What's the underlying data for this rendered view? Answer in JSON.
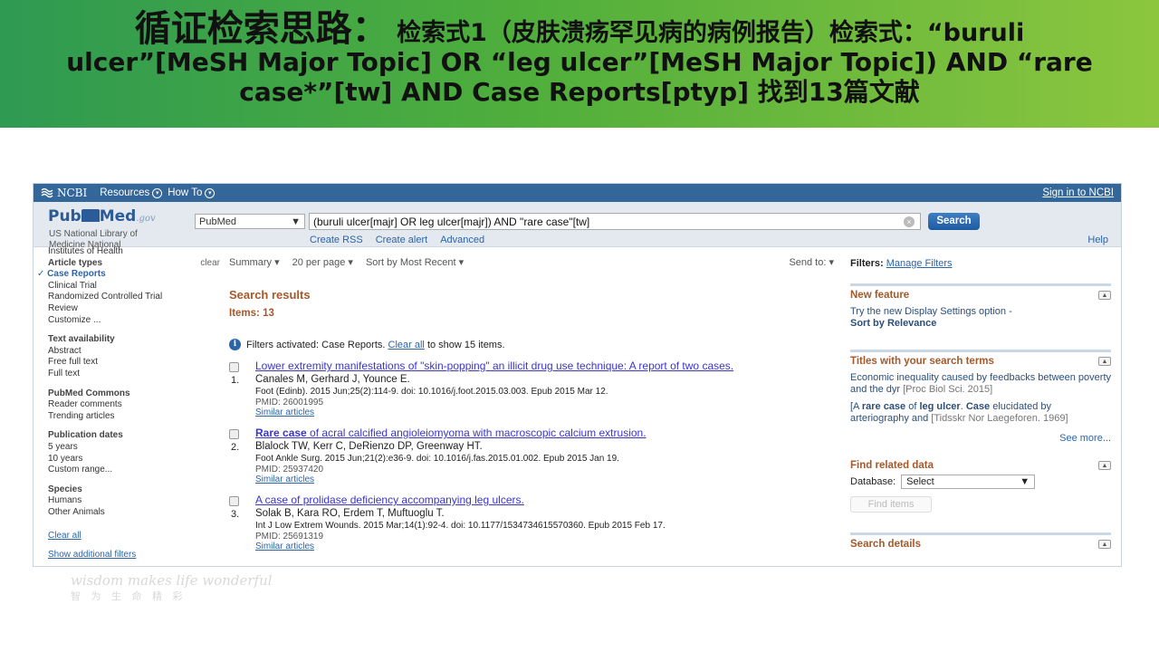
{
  "slide": {
    "title_big": "循证检索思路：",
    "title_rest": " 检索式1（皮肤溃疡罕见病的病例报告）检索式：“buruli",
    "line2": "ulcer”[MeSH Major Topic] OR “leg ulcer”[MeSH Major Topic]) AND “rare",
    "line3": "case*”[tw] AND Case Reports[ptyp] 找到13篇文献"
  },
  "ncbi": {
    "logo": "NCBI",
    "resources": "Resources",
    "howto": "How To",
    "signin": "Sign in to NCBI"
  },
  "search": {
    "logo_pub": "Pub",
    "logo_med": "Med",
    "logo_gov": ".gov",
    "org_line1": "US National Library of",
    "org_line2": "Medicine National",
    "org_line3": "Institutes of Health",
    "db": "PubMed",
    "query": "(buruli ulcer[majr] OR leg ulcer[majr]) AND \"rare case\"[tw]",
    "button": "Search",
    "links": [
      "Create RSS",
      "Create alert",
      "Advanced"
    ],
    "help": "Help"
  },
  "sidebar": {
    "article_types": "Article types",
    "clear": "clear",
    "case_reports": "Case Reports",
    "article_items": [
      "Clinical Trial",
      "Randomized Controlled Trial",
      "Review",
      "Customize ..."
    ],
    "text_availability": "Text availability",
    "text_items": [
      "Abstract",
      "Free full text",
      "Full text"
    ],
    "pubmed_commons": "PubMed Commons",
    "commons_items": [
      "Reader comments",
      "Trending articles"
    ],
    "pub_dates": "Publication dates",
    "date_items": [
      "5 years",
      "10 years",
      "Custom range..."
    ],
    "species": "Species",
    "species_items": [
      "Humans",
      "Other Animals"
    ],
    "clear_all": "Clear all",
    "show_more": "Show additional filters"
  },
  "toolbar": {
    "summary": "Summary",
    "per_page": "20 per page",
    "sort": "Sort by Most Recent",
    "send_to": "Send to:"
  },
  "results": {
    "title": "Search results",
    "items": "Items: 13",
    "filters_text": "Filters activated: Case Reports.",
    "clear_all": "Clear all",
    "show_text": "to show 15 items.",
    "list": [
      {
        "num": "1.",
        "title": "Lower extremity manifestations of \"skin-popping\" an illicit drug use technique: A report of two cases.",
        "authors": "Canales M, Gerhard J, Younce E.",
        "cite": "Foot (Edinb). 2015 Jun;25(2):114-9. doi: 10.1016/j.foot.2015.03.003. Epub 2015 Mar 12.",
        "pmid": "PMID: 26001995",
        "similar": "Similar articles"
      },
      {
        "num": "2.",
        "title_bold": "Rare case",
        "title_rest": " of acral calcified angioleiomyoma with macroscopic calcium extrusion.",
        "authors": "Blalock TW, Kerr C, DeRienzo DP, Greenway HT.",
        "cite": "Foot Ankle Surg. 2015 Jun;21(2):e36-9. doi: 10.1016/j.fas.2015.01.002. Epub 2015 Jan 19.",
        "pmid": "PMID: 25937420",
        "similar": "Similar articles"
      },
      {
        "num": "3.",
        "title": "A case of prolidase deficiency accompanying leg ulcers.",
        "authors": "Solak B, Kara RO, Erdem T, Muftuoglu T.",
        "cite": "Int J Low Extrem Wounds. 2015 Mar;14(1):92-4. doi: 10.1177/1534734615570360. Epub 2015 Feb 17.",
        "pmid": "PMID: 25691319",
        "similar": "Similar articles"
      }
    ]
  },
  "right": {
    "filters_label": "Filters:",
    "manage": "Manage Filters",
    "new_feature": "New feature",
    "nf_text": "Try the new Display Settings option -",
    "nf_bold": "Sort by Relevance",
    "titles_header": "Titles with your search terms",
    "t1_text": "Economic inequality caused by feedbacks between poverty and the dyr",
    "t1_meta": "[Proc Biol Sci. 2015]",
    "t2_pre": "[A ",
    "t2_b1": "rare case",
    "t2_mid": " of ",
    "t2_b2": "leg ulcer",
    "t2_dot": ". ",
    "t2_b3": "Case",
    "t2_rest": " elucidated by arteriography and",
    "t2_meta": "[Tidsskr Nor Laegeforen. 1969]",
    "see_more": "See more...",
    "find_related": "Find related data",
    "database_label": "Database:",
    "database_value": "Select",
    "find_items": "Find items",
    "search_details": "Search details"
  },
  "watermark": {
    "en": "wisdom makes life wonderful",
    "cn": "智 为 生 命 精 彩"
  }
}
